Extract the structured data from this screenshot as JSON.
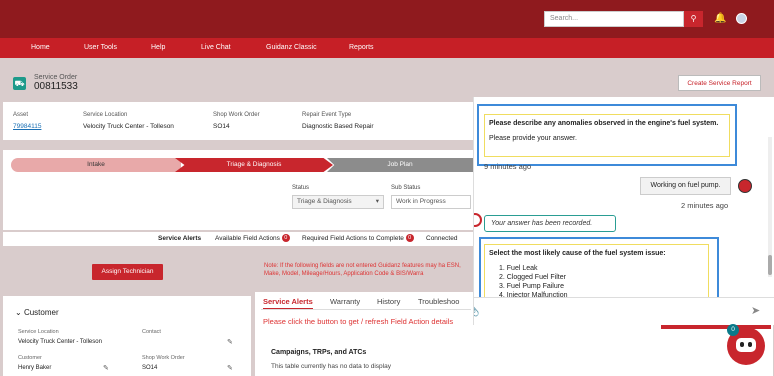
{
  "topbar": {
    "search_placeholder": "Search..."
  },
  "nav": {
    "items": [
      "Home",
      "User Tools",
      "Help",
      "Live Chat",
      "Guidanz Classic",
      "Reports"
    ]
  },
  "header": {
    "label": "Service Order",
    "number": "00811533",
    "create_report": "Create Service Report"
  },
  "info": {
    "asset_label": "Asset",
    "asset_value": "79984115",
    "location_label": "Service Location",
    "location_value": "Velocity Truck Center - Tolleson",
    "shop_label": "Shop Work Order",
    "shop_value": "SO14",
    "repair_label": "Repair Event Type",
    "repair_value": "Diagnostic Based Repair"
  },
  "steps": {
    "s1": "Intake",
    "s2": "Triage & Diagnosis",
    "s3": "Job Plan"
  },
  "status": {
    "status_label": "Status",
    "status_value": "Triage & Diagnosis",
    "sub_label": "Sub Status",
    "sub_value": "Work in Progress"
  },
  "alerts": {
    "title": "Service Alerts",
    "available": "Available Field Actions",
    "available_count": "0",
    "required": "Required Field Actions to Complete",
    "required_count": "0",
    "connected": "Connected"
  },
  "assign_button": "Assign Technician",
  "note": "Note: If the following fields are not entered Guidanz features may ha ESN, Make, Model, Mileage/Hours, Application Code & BIS/Warra",
  "customer": {
    "title": "Customer",
    "loc_label": "Service Location",
    "loc_value": "Velocity Truck Center - Tolleson",
    "contact_label": "Contact",
    "cust_label": "Customer",
    "cust_value": "Henry Baker",
    "swo_label": "Shop Work Order",
    "swo_value": "SO14"
  },
  "tabs": {
    "items": [
      "Service Alerts",
      "Warranty",
      "History",
      "Troubleshoo"
    ],
    "click_msg": "Please click the button to get / refresh Field Action details",
    "refresh_btn": "Refresh Field Action Details",
    "section_title": "Campaigns, TRPs, and ATCs",
    "empty_msg": "This table currently has no data to display"
  },
  "chat": {
    "q1_title": "Please describe any anomalies observed in the engine's fuel system.",
    "q1_sub": "Please provide your answer.",
    "q1_time": "9 minutes ago",
    "user_msg": "Working on fuel pump.",
    "user_time": "2 minutes ago",
    "recorded": "Your answer has been recorded.",
    "q2_title": "Select the most likely cause of the fuel system issue:",
    "q2_options": [
      "1. Fuel Leak",
      "2. Clogged Fuel Filter",
      "3. Fuel Pump Failure",
      "4. Injector Malfunction"
    ],
    "fab_count": "0"
  },
  "colors": {
    "brand": "#c8262d",
    "topbar": "#8f1a1e",
    "highlight": "#3d8ad9"
  }
}
